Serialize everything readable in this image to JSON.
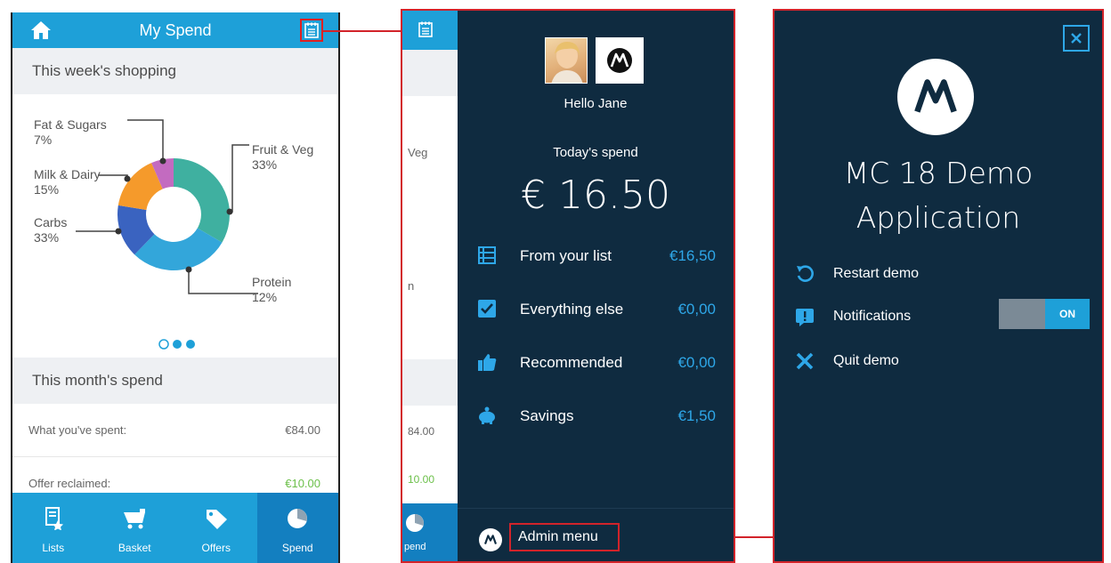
{
  "spend_screen": {
    "title": "My Spend",
    "week_header": "This week's shopping",
    "donut_labels": {
      "fat": {
        "name": "Fat & Sugars",
        "pct": "7%"
      },
      "milk": {
        "name": "Milk & Dairy",
        "pct": "15%"
      },
      "carbs": {
        "name": "Carbs",
        "pct": "33%"
      },
      "fruit": {
        "name": "Fruit & Veg",
        "pct": "33%"
      },
      "protein": {
        "name": "Protein",
        "pct": "12%"
      }
    },
    "month_header": "This month's spend",
    "rows": [
      {
        "label": "What you've spent:",
        "value": "€84.00"
      },
      {
        "label": "Offer reclaimed:",
        "value": "€10.00"
      }
    ],
    "tabs": [
      {
        "label": "Lists"
      },
      {
        "label": "Basket"
      },
      {
        "label": "Offers"
      },
      {
        "label": "Spend"
      }
    ]
  },
  "side_menu": {
    "strip": {
      "veg": "Veg",
      "n": "n",
      "v84": "84.00",
      "v10": "10.00",
      "spend": "pend"
    },
    "greeting": "Hello Jane",
    "today_label": "Today's spend",
    "amount": "€ 16.50",
    "items": [
      {
        "label": "From your list",
        "value": "€16,50"
      },
      {
        "label": "Everything else",
        "value": "€0,00"
      },
      {
        "label": "Recommended",
        "value": "€0,00"
      },
      {
        "label": "Savings",
        "value": "€1,50"
      }
    ],
    "admin_label": "Admin menu"
  },
  "admin_menu": {
    "title_line1": "MC 18 Demo",
    "title_line2": "Application",
    "items": [
      {
        "label": "Restart demo"
      },
      {
        "label": "Notifications"
      },
      {
        "label": "Quit demo"
      }
    ],
    "toggle_state": "ON"
  },
  "colors": {
    "accent_blue": "#1ea0d8",
    "dark_navy": "#0f2b40",
    "highlight_red": "#d2232a",
    "offer_green": "#6cc04a"
  }
}
